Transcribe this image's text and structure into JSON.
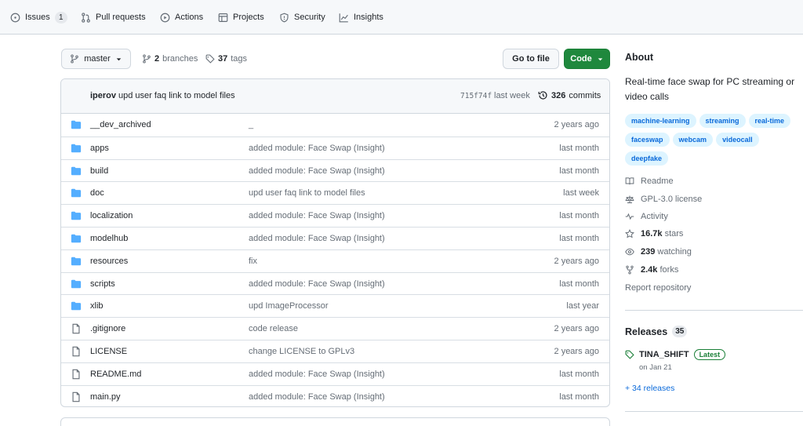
{
  "nav": {
    "issues": {
      "label": "Issues",
      "count": "1"
    },
    "pull_requests": {
      "label": "Pull requests"
    },
    "actions": {
      "label": "Actions"
    },
    "projects": {
      "label": "Projects"
    },
    "security": {
      "label": "Security"
    },
    "insights": {
      "label": "Insights"
    }
  },
  "toolbar": {
    "branch": "master",
    "branches_count": "2",
    "branches_label": "branches",
    "tags_count": "37",
    "tags_label": "tags",
    "go_to_file": "Go to file",
    "code": "Code"
  },
  "latest_commit": {
    "author": "iperov",
    "message": "upd user faq link to model files",
    "sha": "715f74f",
    "time": "last week",
    "commits_count": "326",
    "commits_label": "commits"
  },
  "files": [
    {
      "name": "__dev_archived",
      "type": "folder",
      "message": "_",
      "time": "2 years ago"
    },
    {
      "name": "apps",
      "type": "folder",
      "message": "added module: Face Swap (Insight)",
      "time": "last month"
    },
    {
      "name": "build",
      "type": "folder",
      "message": "added module: Face Swap (Insight)",
      "time": "last month"
    },
    {
      "name": "doc",
      "type": "folder",
      "message": "upd user faq link to model files",
      "time": "last week"
    },
    {
      "name": "localization",
      "type": "folder",
      "message": "added module: Face Swap (Insight)",
      "time": "last month"
    },
    {
      "name": "modelhub",
      "type": "folder",
      "message": "added module: Face Swap (Insight)",
      "time": "last month"
    },
    {
      "name": "resources",
      "type": "folder",
      "message": "fix",
      "time": "2 years ago"
    },
    {
      "name": "scripts",
      "type": "folder",
      "message": "added module: Face Swap (Insight)",
      "time": "last month"
    },
    {
      "name": "xlib",
      "type": "folder",
      "message": "upd ImageProcessor",
      "time": "last year"
    },
    {
      "name": ".gitignore",
      "type": "file",
      "message": "code release",
      "time": "2 years ago"
    },
    {
      "name": "LICENSE",
      "type": "file",
      "message": "change LICENSE to GPLv3",
      "time": "2 years ago"
    },
    {
      "name": "README.md",
      "type": "file",
      "message": "added module: Face Swap (Insight)",
      "time": "last month"
    },
    {
      "name": "main.py",
      "type": "file",
      "message": "added module: Face Swap (Insight)",
      "time": "last month"
    }
  ],
  "about": {
    "heading": "About",
    "description": "Real-time face swap for PC streaming or video calls",
    "topics": [
      "machine-learning",
      "streaming",
      "real-time",
      "faceswap",
      "webcam",
      "videocall",
      "deepfake"
    ],
    "readme": "Readme",
    "license": "GPL-3.0 license",
    "activity": "Activity",
    "stars_count": "16.7k",
    "stars_label": "stars",
    "watching_count": "239",
    "watching_label": "watching",
    "forks_count": "2.4k",
    "forks_label": "forks",
    "report": "Report repository"
  },
  "releases": {
    "heading": "Releases",
    "count": "35",
    "latest_name": "TINA_SHIFT",
    "latest_badge": "Latest",
    "latest_date": "on Jan 21",
    "more": "+ 34 releases"
  },
  "colors": {
    "accent": "#0969da",
    "folder": "#54aeff",
    "green": "#1f883d"
  }
}
